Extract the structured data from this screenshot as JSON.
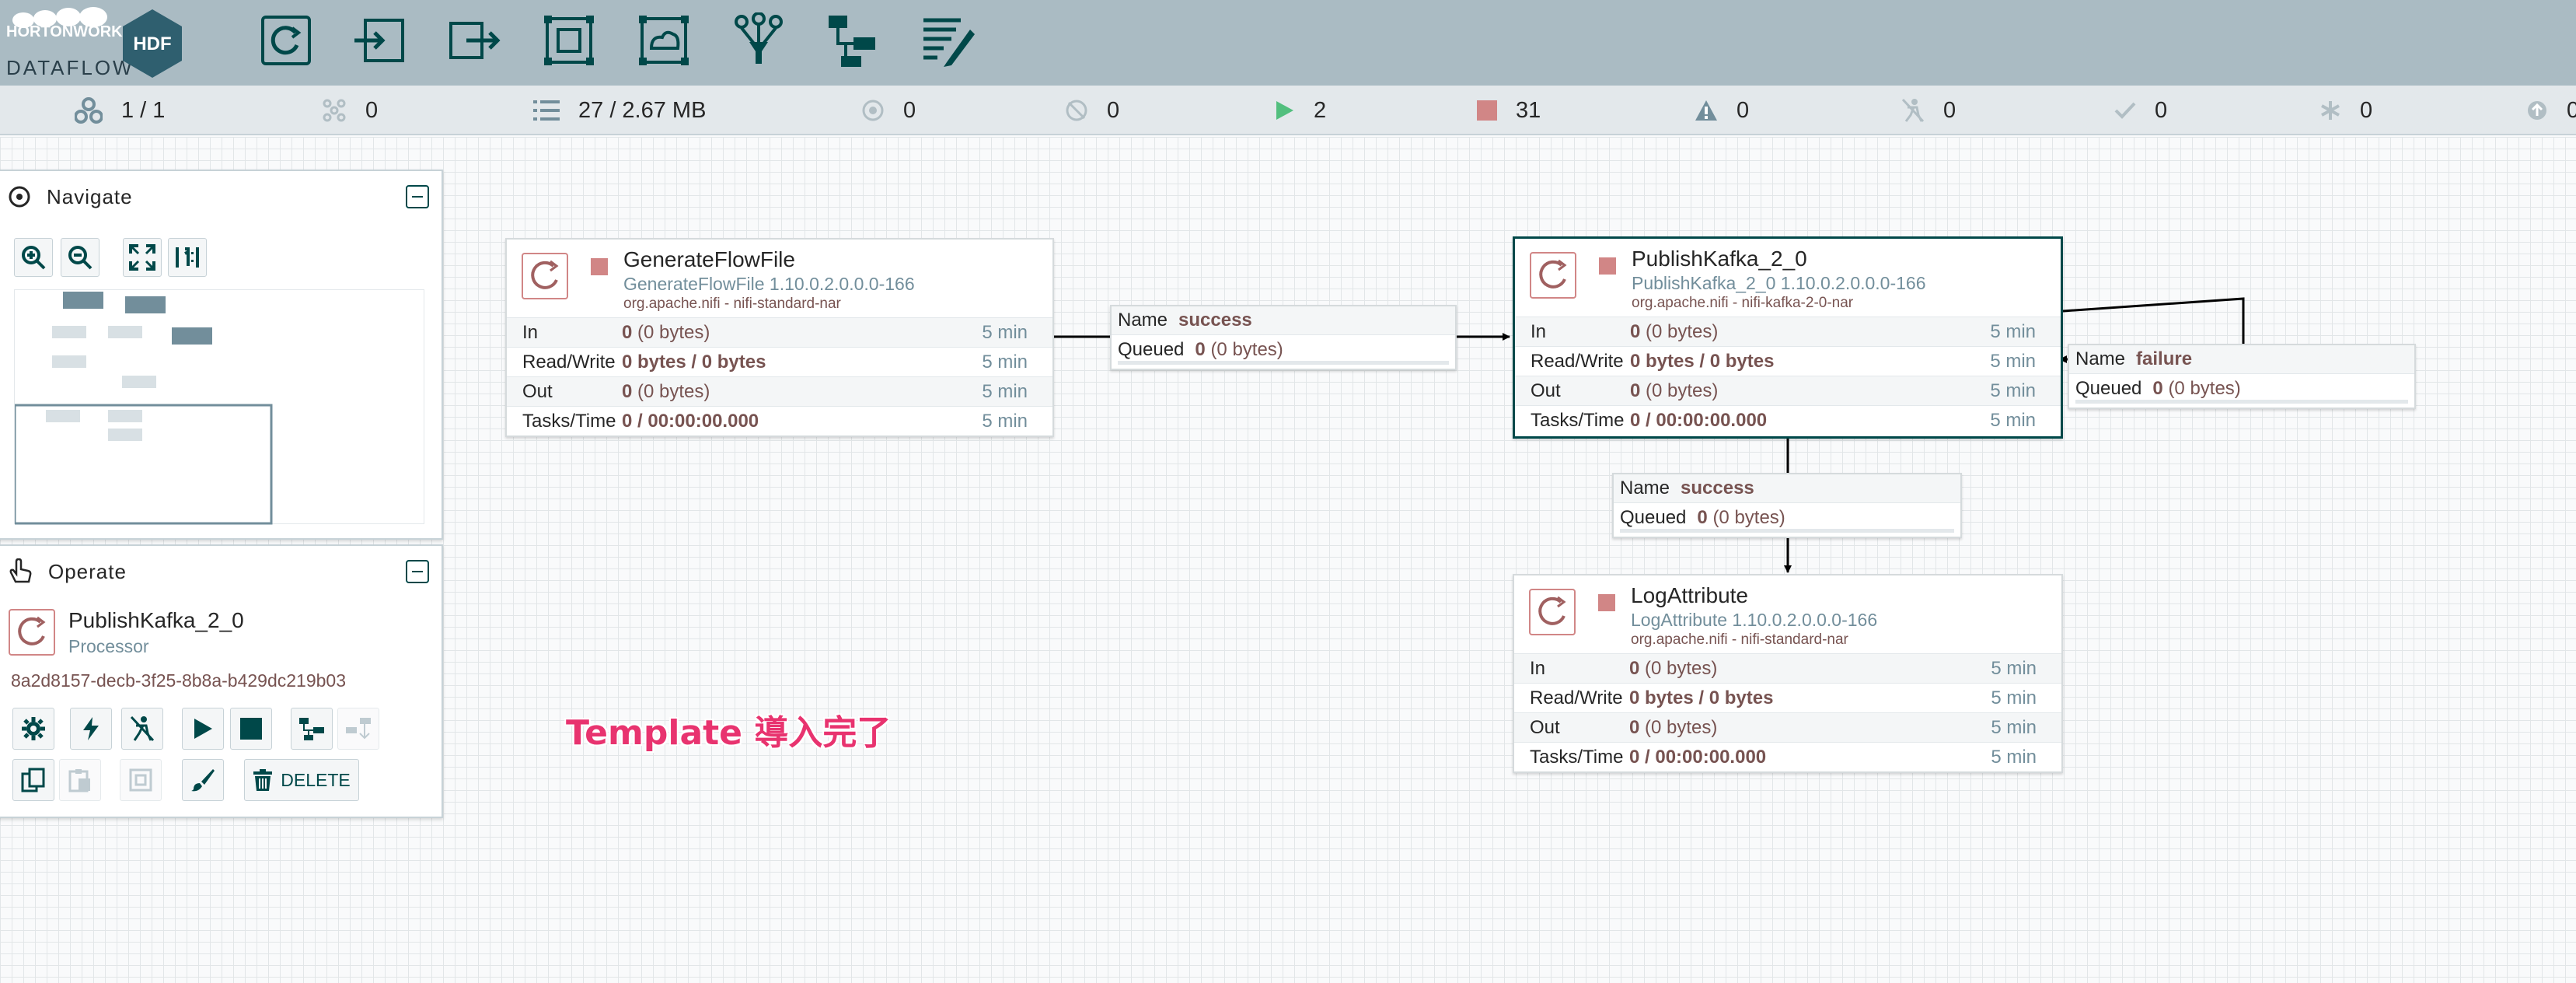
{
  "logo": {
    "brand": "HORTONWORKS",
    "product": "DATAFLOW",
    "badge": "HDF"
  },
  "toolbar": [
    "processor-tool",
    "input-port-tool",
    "output-port-tool",
    "process-group-tool",
    "remote-process-group-tool",
    "funnel-tool",
    "template-tool",
    "label-tool"
  ],
  "status": {
    "cluster": "1 / 1",
    "threads": "0",
    "queued": "27 / 2.67 MB",
    "transmitting": "0",
    "not_transmitting": "0",
    "running": "2",
    "stopped": "31",
    "invalid": "0",
    "disabled": "0",
    "up_to_date": "0",
    "locally_modified": "0",
    "sync_failure": "0"
  },
  "navigate": {
    "title": "Navigate"
  },
  "operate": {
    "title": "Operate",
    "component_name": "PublishKafka_2_0",
    "component_type": "Processor",
    "component_id": "8a2d8157-decb-3f25-8b8a-b429dc219b03",
    "delete_label": "DELETE"
  },
  "row_labels": {
    "in": "In",
    "rw": "Read/Write",
    "out": "Out",
    "tasks": "Tasks/Time"
  },
  "processors": {
    "generate": {
      "name": "GenerateFlowFile",
      "type": "GenerateFlowFile 1.10.0.2.0.0.0-166",
      "bundle": "org.apache.nifi - nifi-standard-nar",
      "in": "0",
      "in_sub": "(0 bytes)",
      "rw": "0 bytes / 0 bytes",
      "out": "0",
      "out_sub": "(0 bytes)",
      "tasks": "0 / 00:00:00.000",
      "window": "5 min"
    },
    "publish": {
      "name": "PublishKafka_2_0",
      "type": "PublishKafka_2_0 1.10.0.2.0.0.0-166",
      "bundle": "org.apache.nifi - nifi-kafka-2-0-nar",
      "in": "0",
      "in_sub": "(0 bytes)",
      "rw": "0 bytes / 0 bytes",
      "out": "0",
      "out_sub": "(0 bytes)",
      "tasks": "0 / 00:00:00.000",
      "window": "5 min"
    },
    "log": {
      "name": "LogAttribute",
      "type": "LogAttribute 1.10.0.2.0.0.0-166",
      "bundle": "org.apache.nifi - nifi-standard-nar",
      "in": "0",
      "in_sub": "(0 bytes)",
      "rw": "0 bytes / 0 bytes",
      "out": "0",
      "out_sub": "(0 bytes)",
      "tasks": "0 / 00:00:00.000",
      "window": "5 min"
    }
  },
  "connections": {
    "labels": {
      "name": "Name",
      "queued": "Queued"
    },
    "c1": {
      "name": "success",
      "queued": "0",
      "queued_sub": "(0 bytes)"
    },
    "c2": {
      "name": "failure",
      "queued": "0",
      "queued_sub": "(0 bytes)"
    },
    "c3": {
      "name": "success",
      "queued": "0",
      "queued_sub": "(0 bytes)"
    }
  },
  "annotation": "Template 導入完了",
  "colors": {
    "header": "#aabbc3",
    "statusbar": "#e3e8eb",
    "accent": "#004849",
    "stopped": "#d18686",
    "running": "#52bf7e",
    "annotation": "#e8336f"
  }
}
